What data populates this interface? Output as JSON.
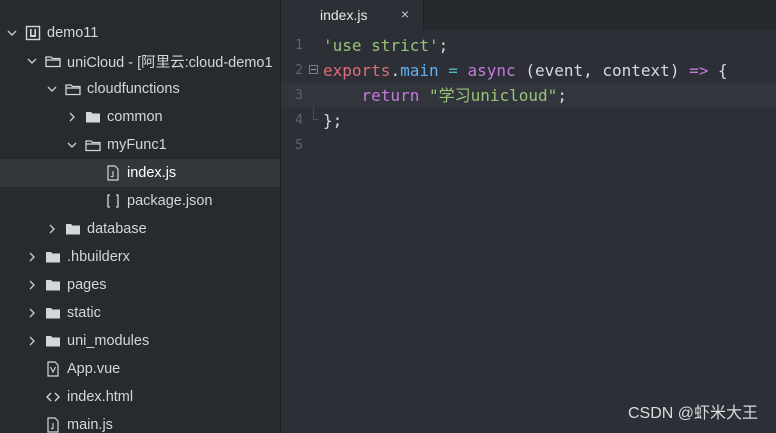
{
  "sidebar": {
    "items": [
      {
        "label": "demo11",
        "depth": 0,
        "expanded": true,
        "icon": "project-icon"
      },
      {
        "label": "uniCloud - [阿里云:cloud-demo1",
        "depth": 1,
        "expanded": true,
        "icon": "folder-open-icon"
      },
      {
        "label": "cloudfunctions",
        "depth": 2,
        "expanded": true,
        "icon": "folder-open-icon"
      },
      {
        "label": "common",
        "depth": 3,
        "expanded": false,
        "icon": "folder-icon"
      },
      {
        "label": "myFunc1",
        "depth": 3,
        "expanded": true,
        "icon": "folder-open-icon"
      },
      {
        "label": "index.js",
        "depth": 4,
        "expanded": null,
        "icon": "js-file-icon",
        "selected": true
      },
      {
        "label": "package.json",
        "depth": 4,
        "expanded": null,
        "icon": "json-file-icon"
      },
      {
        "label": "database",
        "depth": 2,
        "expanded": false,
        "icon": "folder-icon"
      },
      {
        "label": ".hbuilderx",
        "depth": 1,
        "expanded": false,
        "icon": "folder-icon"
      },
      {
        "label": "pages",
        "depth": 1,
        "expanded": false,
        "icon": "folder-icon"
      },
      {
        "label": "static",
        "depth": 1,
        "expanded": false,
        "icon": "folder-icon"
      },
      {
        "label": "uni_modules",
        "depth": 1,
        "expanded": false,
        "icon": "folder-icon"
      },
      {
        "label": "App.vue",
        "depth": 1,
        "expanded": null,
        "icon": "vue-file-icon"
      },
      {
        "label": "index.html",
        "depth": 1,
        "expanded": null,
        "icon": "html-file-icon"
      },
      {
        "label": "main.js",
        "depth": 1,
        "expanded": null,
        "icon": "js-file-icon"
      }
    ]
  },
  "editor": {
    "tab": {
      "label": "index.js",
      "close": "×"
    },
    "lines": [
      {
        "num": "1",
        "tokens": [
          {
            "t": "'use strict'",
            "c": "t-str2"
          },
          {
            "t": ";",
            "c": "t-plain"
          }
        ]
      },
      {
        "num": "2",
        "fold": true,
        "tokens": [
          {
            "t": "exports",
            "c": "t-ident"
          },
          {
            "t": ".",
            "c": "t-plain"
          },
          {
            "t": "main",
            "c": "t-prop"
          },
          {
            "t": " = ",
            "c": "t-op"
          },
          {
            "t": "async",
            "c": "t-kw"
          },
          {
            "t": " (event, context) ",
            "c": "t-paren"
          },
          {
            "t": "=>",
            "c": "t-kw"
          },
          {
            "t": " {",
            "c": "t-plain"
          }
        ]
      },
      {
        "num": "3",
        "current": true,
        "tokens": [
          {
            "t": "    return",
            "c": "t-kw"
          },
          {
            "t": " ",
            "c": "t-plain"
          },
          {
            "t": "\"学习unicloud\"",
            "c": "t-str2"
          },
          {
            "t": ";",
            "c": "t-plain"
          }
        ]
      },
      {
        "num": "4",
        "tokens": [
          {
            "t": "};",
            "c": "t-plain"
          }
        ]
      },
      {
        "num": "5",
        "tokens": []
      }
    ]
  },
  "watermark": "CSDN @虾米大王",
  "colors": {
    "sidebar_bg": "#272a2e",
    "editor_bg": "#2c3036",
    "selected_row": "#33363b"
  }
}
